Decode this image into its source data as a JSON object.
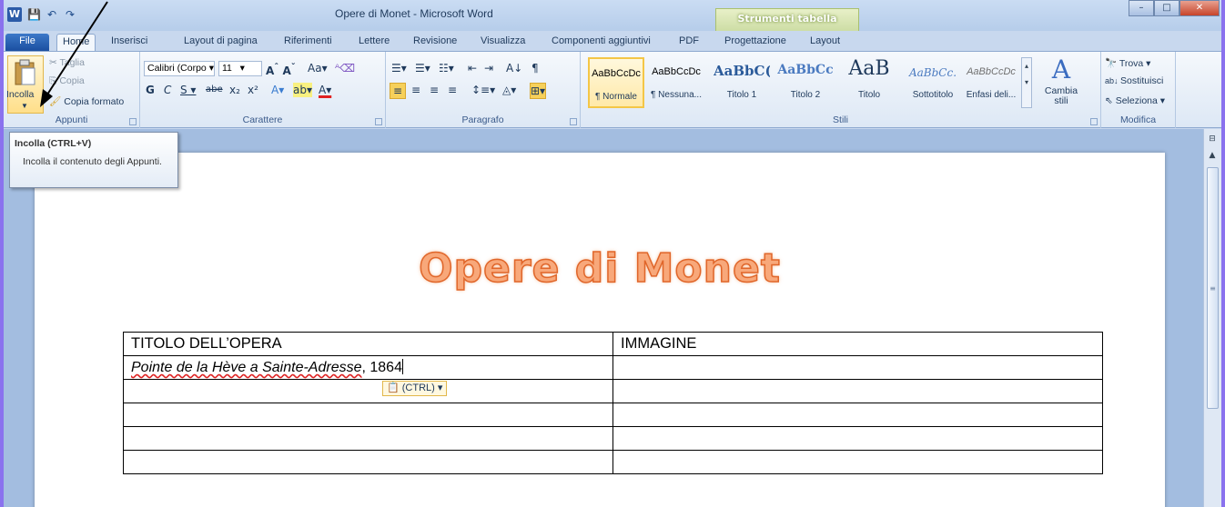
{
  "window": {
    "title": "Opere di Monet  -  Microsoft Word",
    "context_group": "Strumenti tabella",
    "minimize": "–",
    "maximize": "□",
    "close": "✕"
  },
  "qat": {
    "save_icon": "💾",
    "undo_icon": "↶",
    "redo_icon": "↷",
    "app_letter": "W"
  },
  "tabs": [
    "File",
    "Home",
    "Inserisci",
    "Layout di pagina",
    "Riferimenti",
    "Lettere",
    "Revisione",
    "Visualizza",
    "Componenti aggiuntivi",
    "PDF",
    "Progettazione",
    "Layout"
  ],
  "ribbon": {
    "clipboard": {
      "label": "Appunti",
      "paste": "Incolla",
      "cut": "Taglia",
      "copy": "Copia",
      "format_painter": "Copia formato"
    },
    "font": {
      "label": "Carattere",
      "font_name": "Calibri (Corpo",
      "font_size": "11"
    },
    "paragraph": {
      "label": "Paragrafo"
    },
    "styles": {
      "label": "Stili",
      "items": [
        {
          "sample": "AaBbCcDc",
          "name": "¶ Normale"
        },
        {
          "sample": "AaBbCcDc",
          "name": "¶ Nessuna..."
        },
        {
          "sample": "AaBbC(",
          "name": "Titolo 1"
        },
        {
          "sample": "AaBbCc",
          "name": "Titolo 2"
        },
        {
          "sample": "AaB",
          "name": "Titolo"
        },
        {
          "sample": "AaBbCc.",
          "name": "Sottotitolo"
        },
        {
          "sample": "AaBbCcDc",
          "name": "Enfasi deli..."
        }
      ],
      "change_styles": "Cambia stili"
    },
    "editing": {
      "label": "Modifica",
      "find": "Trova",
      "replace": "Sostituisci",
      "select": "Seleziona"
    }
  },
  "tooltip": {
    "title": "Incolla (CTRL+V)",
    "body": "Incolla il contenuto degli Appunti."
  },
  "document": {
    "title": "Opere di Monet",
    "table": {
      "headers": [
        "TITOLO DELL’OPERA",
        "IMMAGINE"
      ],
      "rows": [
        [
          "Pointe de la Hève a Sainte-Adresse",
          ""
        ],
        [
          "",
          ""
        ],
        [
          "",
          ""
        ],
        [
          "",
          ""
        ],
        [
          "",
          ""
        ]
      ],
      "first_row_suffix": ", 1864"
    },
    "paste_options": "(CTRL)"
  },
  "colors": {
    "accent": "#1e395b",
    "title_fill": "#f8a87a",
    "title_stroke": "#e0662a",
    "context_tab": "#cddda5"
  }
}
